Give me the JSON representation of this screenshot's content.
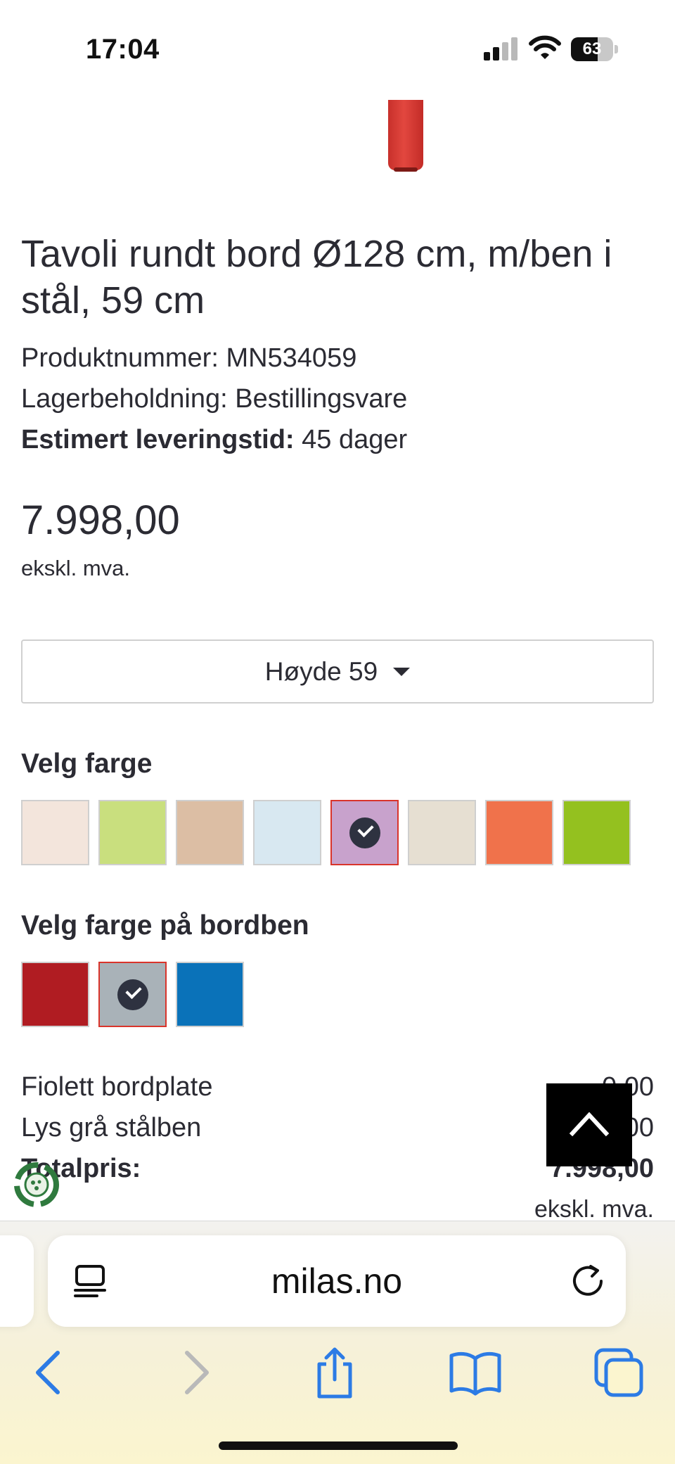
{
  "status_bar": {
    "time": "17:04",
    "battery": "63",
    "battery_level": 0.63
  },
  "product": {
    "title": "Tavoli rundt bord Ø128 cm, m/ben i stål, 59 cm",
    "product_number": "Produktnummer: MN534059",
    "stock": "Lagerbeholdning: Bestillingsvare",
    "delivery_label": "Estimert leveringstid:",
    "delivery_value": " 45 dager",
    "price": "7.998,00",
    "price_note": "ekskl. mva."
  },
  "height_select": {
    "label": "Høyde 59"
  },
  "tabletop_colors": {
    "label": "Velg farge",
    "swatches": [
      {
        "color": "#f3e5dc",
        "selected": false
      },
      {
        "color": "#c9df7e",
        "selected": false
      },
      {
        "color": "#dcbea4",
        "selected": false
      },
      {
        "color": "#d8e8f1",
        "selected": false
      },
      {
        "color": "#c8a2cc",
        "selected": true
      },
      {
        "color": "#e6dfd2",
        "selected": false
      },
      {
        "color": "#f0724b",
        "selected": false
      },
      {
        "color": "#94c11f",
        "selected": false
      }
    ]
  },
  "leg_colors": {
    "label": "Velg farge på bordben",
    "swatches": [
      {
        "color": "#b01c22",
        "selected": false
      },
      {
        "color": "#a9b2b8",
        "selected": true
      },
      {
        "color": "#0a72b9",
        "selected": false
      }
    ]
  },
  "summary": {
    "line1_label": "Fiolett bordplate",
    "line1_value": "0,00",
    "line2_label": "Lys grå stålben",
    "line2_value": "0,00",
    "total_label": "Totalpris:",
    "total_value": "7.998,00",
    "total_note": "ekskl. mva."
  },
  "browser": {
    "url": "milas.no"
  },
  "colors": {
    "accent_red": "#d9342b",
    "safari_blue": "#2c7be5"
  }
}
